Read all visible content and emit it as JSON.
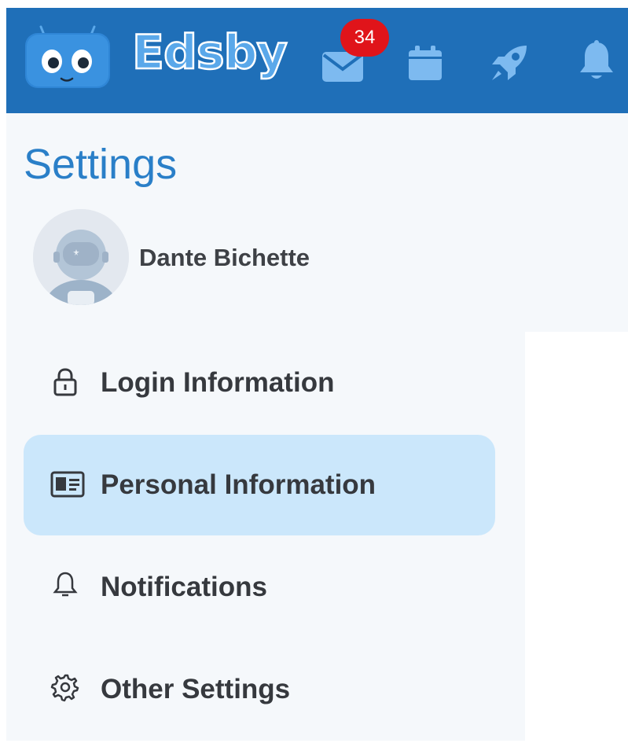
{
  "header": {
    "app_name": "Edsby",
    "mail_badge_count": "34",
    "background_color": "#1f6fb8",
    "icons": [
      "mail-icon",
      "calendar-icon",
      "rocket-icon",
      "bell-icon"
    ]
  },
  "page": {
    "title": "Settings"
  },
  "user": {
    "name": "Dante Bichette",
    "avatar_icon": "astronaut-avatar"
  },
  "nav": {
    "items": [
      {
        "label": "Login Information",
        "icon": "lock-icon",
        "active": false
      },
      {
        "label": "Personal Information",
        "icon": "id-card-icon",
        "active": true
      },
      {
        "label": "Notifications",
        "icon": "bell-outline-icon",
        "active": false
      },
      {
        "label": "Other Settings",
        "icon": "gear-icon",
        "active": false
      }
    ]
  },
  "colors": {
    "accent": "#2a7fc8",
    "active_item_bg": "#cbe7fb",
    "badge": "#e0141a",
    "sidebar_bg": "#f5f8fb"
  }
}
